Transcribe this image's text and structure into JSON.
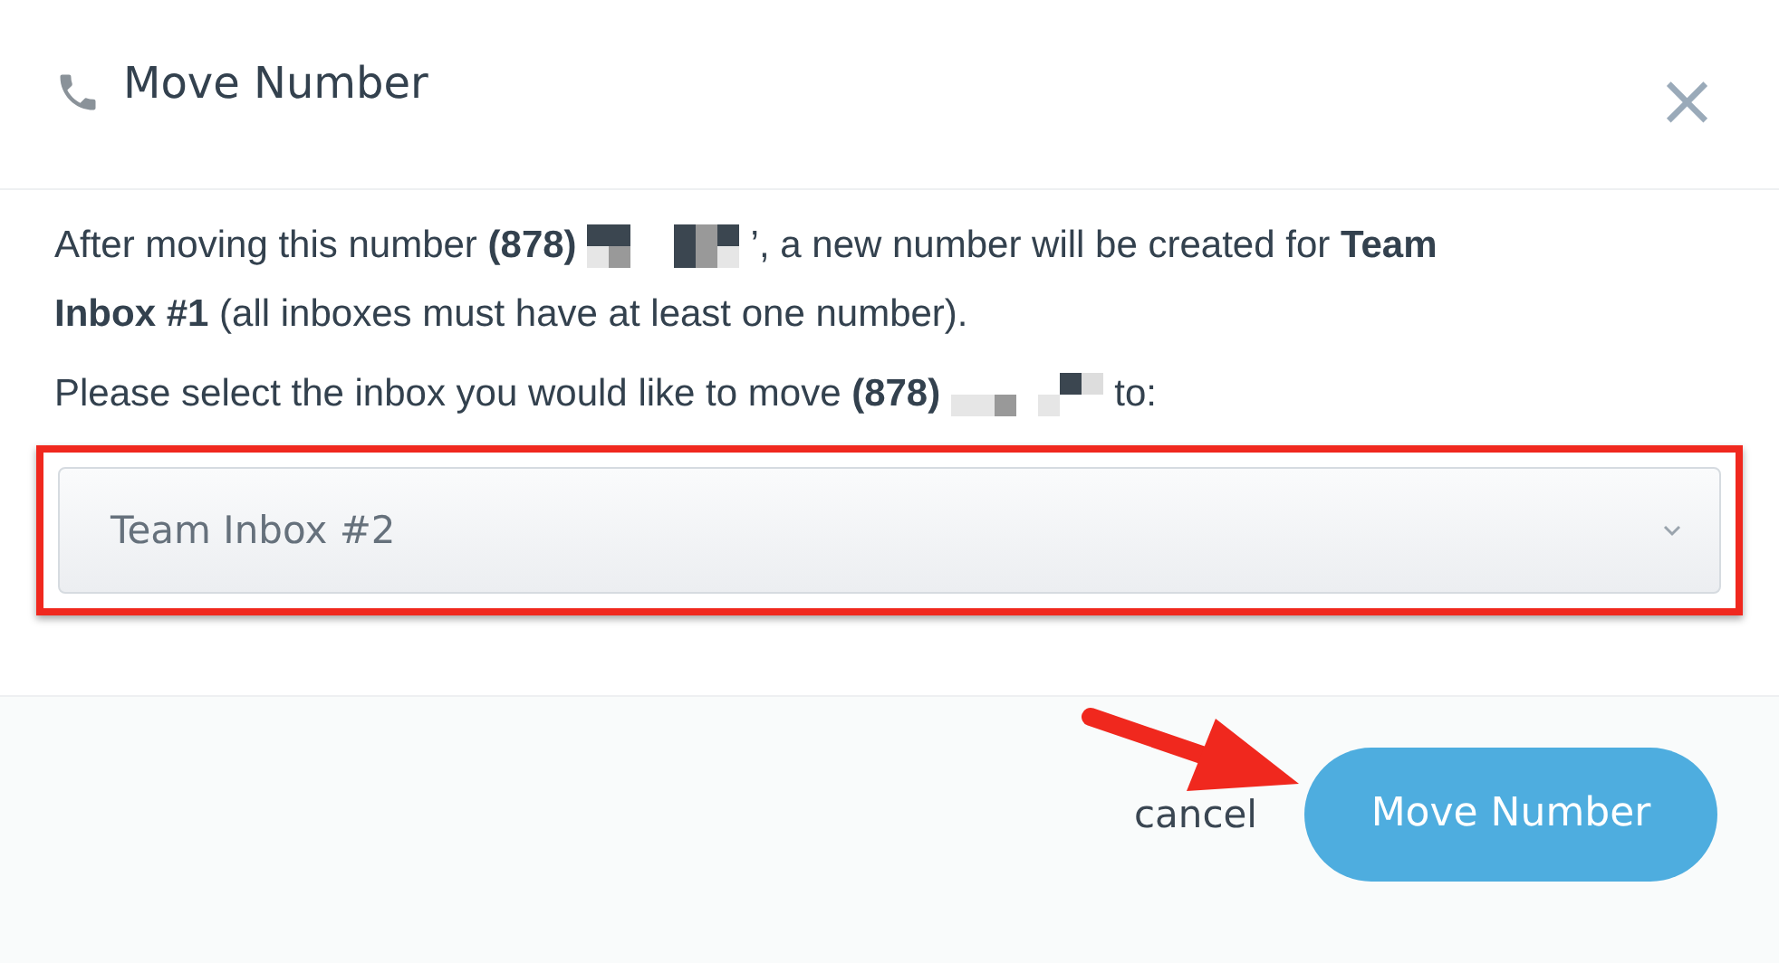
{
  "dialog": {
    "title": "Move Number",
    "close": "×"
  },
  "message": {
    "before": "After moving this number **(878)**",
    "after": "’, a new number will be created for **Team**",
    "continued": "**Inbox #1** (all inboxes must have at least one number)."
  },
  "prompt": {
    "before": "Please select the inbox you would like to move **(878)**",
    "after": "to:"
  },
  "select": {
    "value": "Team Inbox #2",
    "highlighted": true
  },
  "footer": {
    "cancel": "cancel",
    "confirm": "Move Number",
    "arrow": true
  }
}
